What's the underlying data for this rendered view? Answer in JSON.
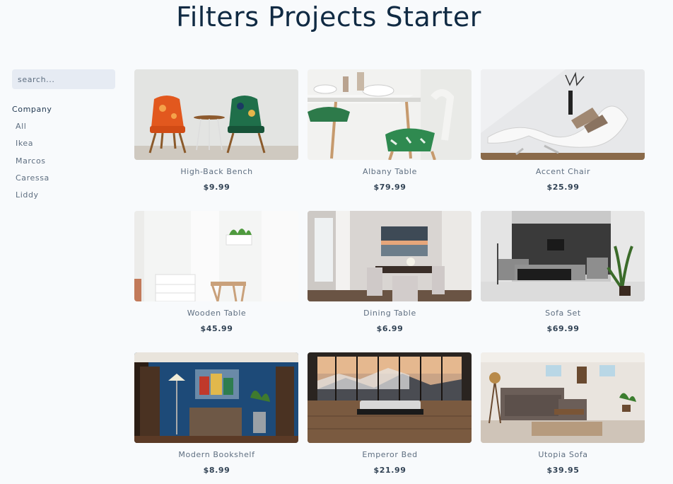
{
  "page": {
    "title": "Filters Projects Starter"
  },
  "search": {
    "placeholder": "search..."
  },
  "filters": {
    "heading": "Company",
    "companies": [
      "All",
      "Ikea",
      "Marcos",
      "Caressa",
      "Liddy"
    ]
  },
  "products": [
    {
      "name": "High-Back Bench",
      "price": "$9.99",
      "image": "armchairs-photo"
    },
    {
      "name": "Albany Table",
      "price": "$79.99",
      "image": "dining-table-photo"
    },
    {
      "name": "Accent Chair",
      "price": "$25.99",
      "image": "lounge-chair-photo"
    },
    {
      "name": "Wooden Table",
      "price": "$45.99",
      "image": "white-room-photo"
    },
    {
      "name": "Dining Table",
      "price": "$6.99",
      "image": "dining-room-photo"
    },
    {
      "name": "Sofa Set",
      "price": "$69.99",
      "image": "living-room-photo"
    },
    {
      "name": "Modern Bookshelf",
      "price": "$8.99",
      "image": "blue-room-photo"
    },
    {
      "name": "Emperor Bed",
      "price": "$21.99",
      "image": "bed-photo"
    },
    {
      "name": "Utopia Sofa",
      "price": "$39.95",
      "image": "sofa-room-photo"
    }
  ]
}
